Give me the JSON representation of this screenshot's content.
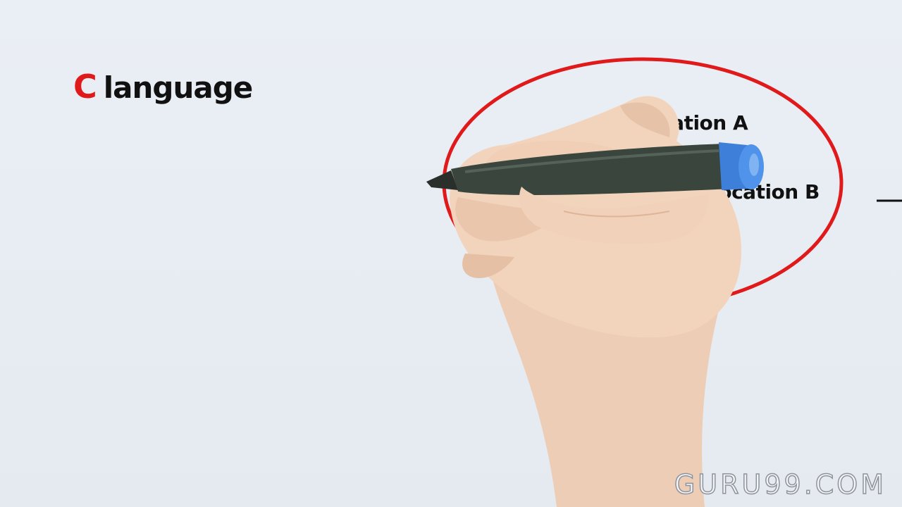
{
  "title": {
    "highlight": "C",
    "rest": "language"
  },
  "diagram": {
    "location_a": "Location A",
    "location_b": "Location B"
  },
  "watermark": "GURU99.COM",
  "colors": {
    "background": "#e7ecf2",
    "accent_red": "#e01a1a",
    "marker_body": "#3a463d",
    "marker_cap": "#3d7fd9",
    "skin": "#f0d2ba"
  },
  "icons": {
    "hand": "hand-icon",
    "marker": "marker-pen-icon"
  }
}
